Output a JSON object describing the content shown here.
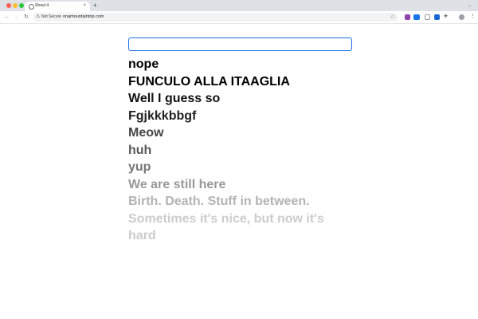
{
  "browser": {
    "tab_title": "Shout it",
    "tab_close": "×",
    "new_tab": "+",
    "tab_menu": "⌄",
    "nav": {
      "back": "←",
      "forward": "→",
      "reload": "↻"
    },
    "security_label": "Not Secure",
    "url": "onamountaintop.com",
    "bookmark": "☆",
    "menu": "⋮"
  },
  "page": {
    "input": {
      "value": "",
      "placeholder": ""
    },
    "shouts": [
      {
        "text": "nope",
        "color": "#000000"
      },
      {
        "text": "FUNCULO ALLA ITAAGLIA",
        "color": "#000000"
      },
      {
        "text": "Well I guess so",
        "color": "#111111"
      },
      {
        "text": "Fgjkkkbbgf",
        "color": "#222222"
      },
      {
        "text": "Meow",
        "color": "#444444"
      },
      {
        "text": "huh",
        "color": "#5a5a5a"
      },
      {
        "text": "yup",
        "color": "#777777"
      },
      {
        "text": "We are still here",
        "color": "#999999"
      },
      {
        "text": "Birth. Death. Stuff in between.",
        "color": "#b3b3b3"
      },
      {
        "text": "Sometimes it's nice, but now it's hard",
        "color": "#cccccc"
      }
    ]
  }
}
